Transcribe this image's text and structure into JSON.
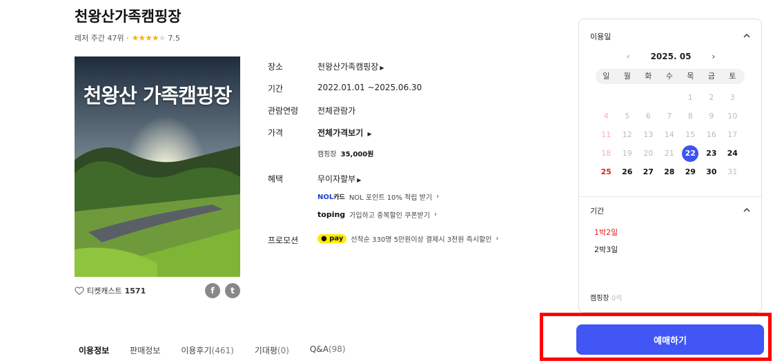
{
  "title": "천왕산가족캠핑장",
  "rank_text": "레저 주간 47위 ·",
  "rating": 4,
  "rating_max": 5,
  "rating_value": "7.5",
  "poster_title": "천왕산 가족캠핑장",
  "wishlist": {
    "label": "티켓캐스트",
    "count": "1571"
  },
  "social": {
    "facebook": "f",
    "twitter": "t"
  },
  "info": {
    "place_label": "장소",
    "place_value": "천왕산가족캠핑장",
    "period_label": "기간",
    "period_value": "2022.01.01 ~2025.06.30",
    "age_label": "관람연령",
    "age_value": "전체관람가",
    "price_label": "가격",
    "price_value": "전체가격보기",
    "price_item_name": "캠핑장",
    "price_item_value": "35,000원",
    "benefit_label": "혜택",
    "benefit_value": "무이자할부",
    "nol_brand": "NOL",
    "nol_card": "카드",
    "nol_text": "NOL 포인트 10% 적립 받기",
    "toping_brand": "toping",
    "toping_text": "가입하고 중복할인 쿠폰받기",
    "promo_label": "프로모션",
    "pay_brand": "pay",
    "promo_text": "선착순 330명 5만원이상 결제시 3천원 즉시할인"
  },
  "tabs": [
    {
      "label": "이용정보",
      "count": ""
    },
    {
      "label": "판매정보",
      "count": ""
    },
    {
      "label": "이용후기",
      "count": "(461)"
    },
    {
      "label": "기대평",
      "count": "(0)"
    },
    {
      "label": "Q&A",
      "count": "(98)"
    }
  ],
  "sidebar": {
    "date_header": "이용일",
    "month": "2025. 05",
    "prev": "‹",
    "next": "›",
    "weekdays": [
      "일",
      "월",
      "화",
      "수",
      "목",
      "금",
      "토"
    ],
    "selected_day": 22,
    "weeks": [
      [
        "",
        "",
        "",
        "",
        "1",
        "2",
        "3"
      ],
      [
        "4",
        "5",
        "6",
        "7",
        "8",
        "9",
        "10"
      ],
      [
        "11",
        "12",
        "13",
        "14",
        "15",
        "16",
        "17"
      ],
      [
        "18",
        "19",
        "20",
        "21",
        "22",
        "23",
        "24"
      ],
      [
        "25",
        "26",
        "27",
        "28",
        "29",
        "30",
        "31"
      ]
    ],
    "available_days": [
      22,
      23,
      24,
      25,
      26,
      27,
      28,
      29,
      30
    ],
    "period_header": "기간",
    "options": [
      "1박2일",
      "2박3일"
    ],
    "seat_label": "캠핑장",
    "seat_remaining": "0석"
  },
  "book_button": "예매하기"
}
